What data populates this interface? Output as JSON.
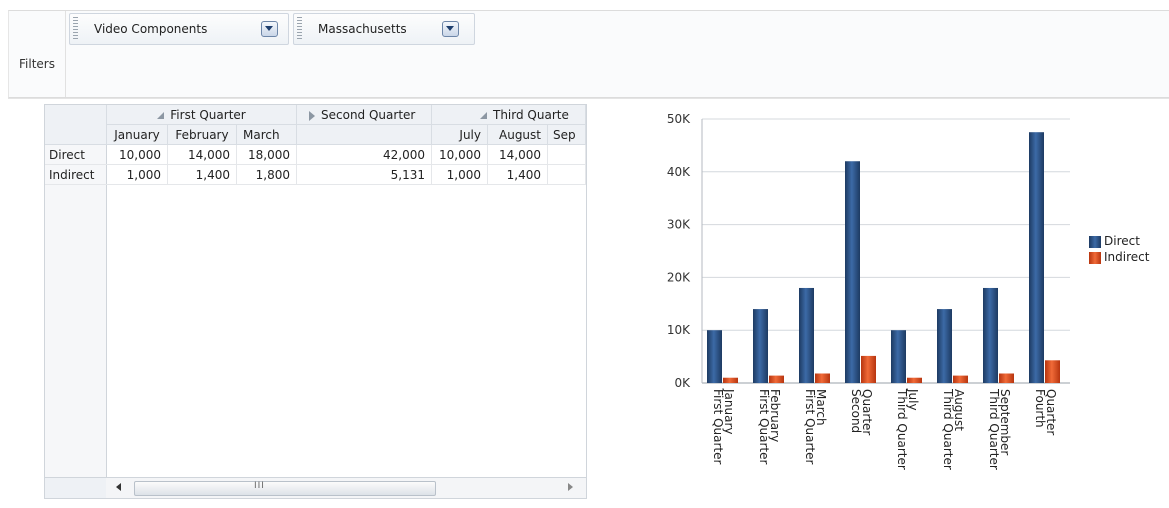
{
  "filters": {
    "label": "Filters",
    "items": [
      {
        "value": "Video Components"
      },
      {
        "value": "Massachusetts"
      }
    ]
  },
  "pivot": {
    "quarters": [
      {
        "label": "First Quarter",
        "state": "expanded"
      },
      {
        "label": "Second Quarter",
        "state": "collapsed"
      },
      {
        "label": "Third Quarte",
        "state": "expanded"
      }
    ],
    "months": [
      "January",
      "February",
      "March",
      "",
      "July",
      "August",
      "Sep"
    ],
    "rows": [
      {
        "label": "Direct",
        "values": [
          "10,000",
          "14,000",
          "18,000",
          "42,000",
          "10,000",
          "14,000",
          ""
        ]
      },
      {
        "label": "Indirect",
        "values": [
          "1,000",
          "1,400",
          "1,800",
          "5,131",
          "1,000",
          "1,400",
          ""
        ]
      }
    ],
    "scroll_grip": "III"
  },
  "chart_data": {
    "type": "bar",
    "categories": [
      [
        "First Quarter",
        "January"
      ],
      [
        "First Quarter",
        "February"
      ],
      [
        "First Quarter",
        "March"
      ],
      [
        "Second",
        "Quarter"
      ],
      [
        "Third Quarter",
        "July"
      ],
      [
        "Third Quarter",
        "August"
      ],
      [
        "Third Quarter",
        "September"
      ],
      [
        "Fourth",
        "Quarter"
      ]
    ],
    "series": [
      {
        "name": "Direct",
        "color": "#2a4f80",
        "values": [
          10000,
          14000,
          18000,
          42000,
          10000,
          14000,
          18000,
          47500
        ]
      },
      {
        "name": "Indirect",
        "color": "#d9481c",
        "values": [
          1000,
          1400,
          1800,
          5131,
          1000,
          1400,
          1800,
          4300
        ]
      }
    ],
    "ylim": [
      0,
      50000
    ],
    "yticks": [
      "0K",
      "10K",
      "20K",
      "30K",
      "40K",
      "50K"
    ],
    "grid": true,
    "legend_position": "right"
  }
}
